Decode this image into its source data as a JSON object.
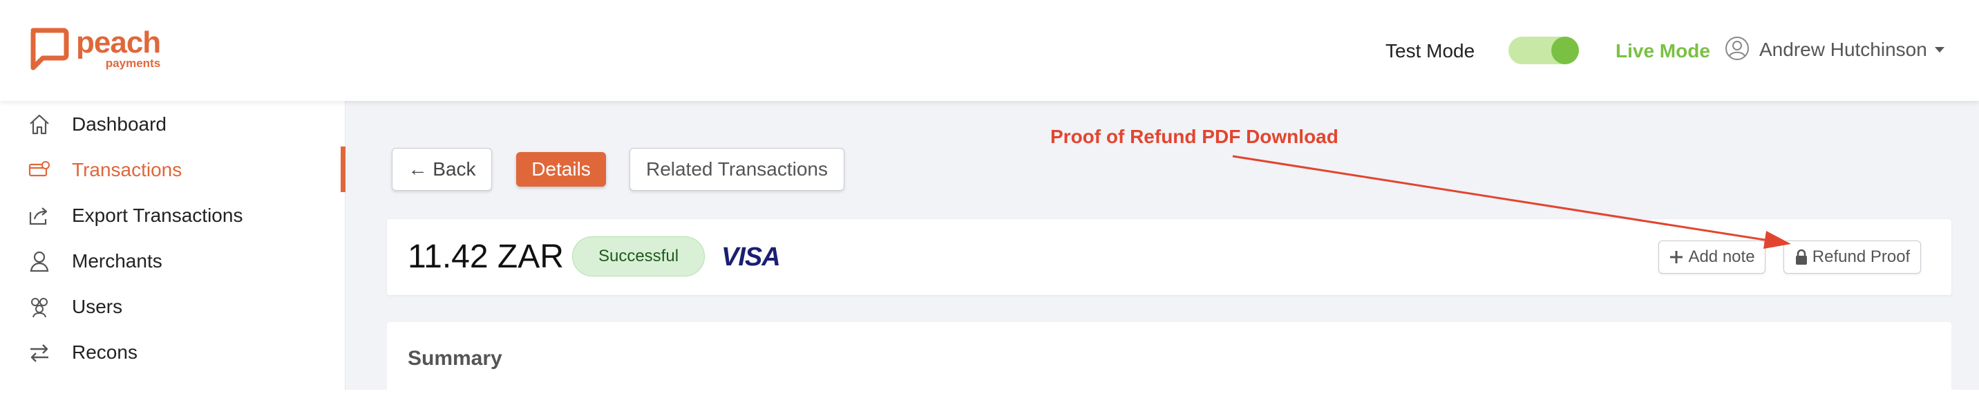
{
  "brand": {
    "name": "peach",
    "sub": "payments",
    "color": "#e0673a"
  },
  "header": {
    "test_mode_label": "Test Mode",
    "live_mode_label": "Live Mode",
    "mode_toggle_on": true,
    "user_name": "Andrew Hutchinson",
    "live_color": "#7ac143"
  },
  "sidebar": {
    "items": [
      {
        "label": "Dashboard",
        "icon": "home-icon",
        "active": false
      },
      {
        "label": "Transactions",
        "icon": "card-icon",
        "active": true
      },
      {
        "label": "Export Transactions",
        "icon": "export-icon",
        "active": false
      },
      {
        "label": "Merchants",
        "icon": "merchant-icon",
        "active": false
      },
      {
        "label": "Users",
        "icon": "users-icon",
        "active": false
      },
      {
        "label": "Recons",
        "icon": "swap-arrows-icon",
        "active": false
      }
    ]
  },
  "tabs": {
    "back_label": "← Back",
    "details_label": "Details",
    "related_label": "Related Transactions"
  },
  "annotation": {
    "text": "Proof of Refund PDF Download",
    "color": "#e2452f"
  },
  "transaction": {
    "amount": "11.42 ZAR",
    "status": "Successful",
    "card_brand": "VISA",
    "add_note_label": "Add note",
    "refund_proof_label": "Refund Proof"
  },
  "summary": {
    "title": "Summary"
  }
}
